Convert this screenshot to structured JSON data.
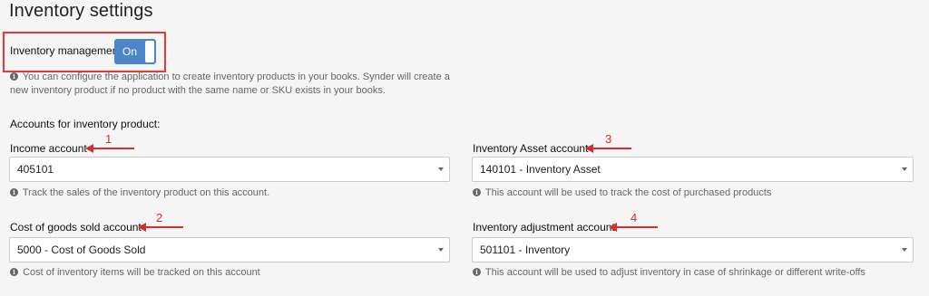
{
  "page": {
    "title": "Inventory settings"
  },
  "inventory_management": {
    "label": "Inventory management",
    "toggle_text": "On",
    "info_line1": "You can configure the application to create inventory products in your books. Synder will create a",
    "info_line2": "new inventory product if no product with the same name or SKU exists in your books."
  },
  "accounts_section": {
    "heading": "Accounts for inventory product:"
  },
  "fields": {
    "income": {
      "label": "Income account",
      "value": "405101",
      "info": "Track the sales of the inventory product on this account.",
      "annotation": "1"
    },
    "inventory_asset": {
      "label": "Inventory Asset account",
      "value": "140101 - Inventory Asset",
      "info": "This account will be used to track the cost of purchased products",
      "annotation": "3"
    },
    "cogs": {
      "label": "Cost of goods sold account",
      "value": "5000 - Cost of Goods Sold",
      "info": "Cost of inventory items will be tracked on this account",
      "annotation": "2"
    },
    "inventory_adjustment": {
      "label": "Inventory adjustment account",
      "value": "501101 - Inventory",
      "info": "This account will be used to adjust inventory in case of shrinkage or different write-offs",
      "annotation": "4"
    }
  },
  "colors": {
    "toggle_on": "#4a86c8",
    "highlight_box": "#e53935",
    "annotation": "#d32f2f",
    "background": "#f5f5f5"
  },
  "icons": {
    "info": "info-circle-icon",
    "dropdown": "caret-down-icon",
    "annotation_arrow": "arrow-left-icon"
  }
}
